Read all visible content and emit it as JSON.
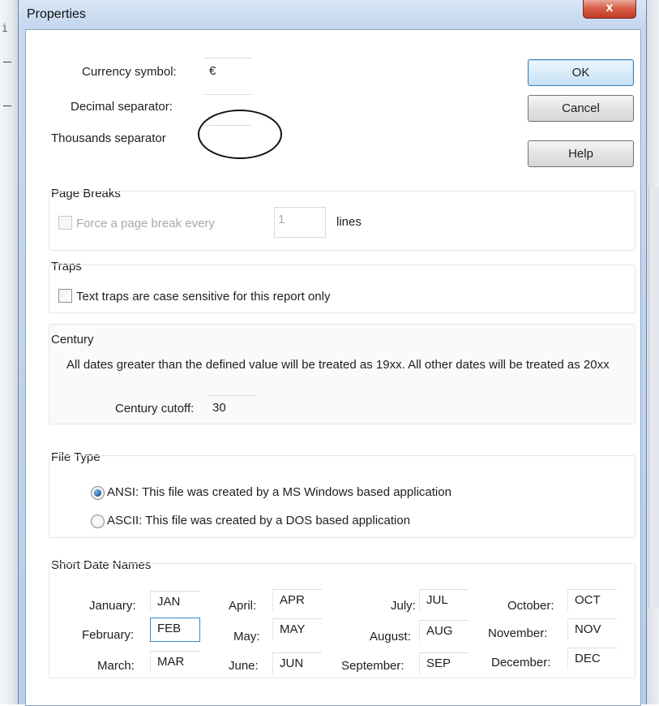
{
  "background": {
    "left_glyph": "i"
  },
  "window": {
    "title": "Properties",
    "close_label": "x"
  },
  "buttons": {
    "ok": "OK",
    "cancel": "Cancel",
    "help": "Help"
  },
  "currency": {
    "currency_label": "Currency symbol:",
    "currency_value": "€",
    "decimal_label": "Decimal separator:",
    "decimal_value": "",
    "thousands_label": "Thousands separator",
    "thousands_value": ""
  },
  "page_breaks": {
    "title": "Page Breaks",
    "checkbox_label": "Force a page break every",
    "lines_value": "1",
    "lines_suffix": "lines",
    "checked": false,
    "enabled": false
  },
  "traps": {
    "title": "Traps",
    "checkbox_label": "Text traps are case sensitive for this report only",
    "checked": false
  },
  "century": {
    "title": "Century",
    "description": "All dates greater than the defined value will be treated as 19xx.  All other dates will be treated as 20xx",
    "cutoff_label": "Century cutoff:",
    "cutoff_value": "30"
  },
  "file_type": {
    "title": "File Type",
    "options": [
      {
        "label": "ANSI: This file was created by a MS Windows based application",
        "selected": true
      },
      {
        "label": "ASCII: This file was created by a DOS based application",
        "selected": false
      }
    ]
  },
  "short_date_names": {
    "title": "Short Date Names",
    "months": [
      {
        "label": "January:",
        "value": "JAN"
      },
      {
        "label": "February:",
        "value": "FEB"
      },
      {
        "label": "March:",
        "value": "MAR"
      },
      {
        "label": "April:",
        "value": "APR"
      },
      {
        "label": "May:",
        "value": "MAY"
      },
      {
        "label": "June:",
        "value": "JUN"
      },
      {
        "label": "July:",
        "value": "JUL"
      },
      {
        "label": "August:",
        "value": "AUG"
      },
      {
        "label": "September:",
        "value": "SEP"
      },
      {
        "label": "October:",
        "value": "OCT"
      },
      {
        "label": "November:",
        "value": "NOV"
      },
      {
        "label": "December:",
        "value": "DEC"
      }
    ]
  },
  "colors": {
    "window_frame": "#c8daf0",
    "close_button": "#c33a22",
    "default_button_border": "#3c7fb1",
    "annotation_ellipse": "#111111"
  }
}
